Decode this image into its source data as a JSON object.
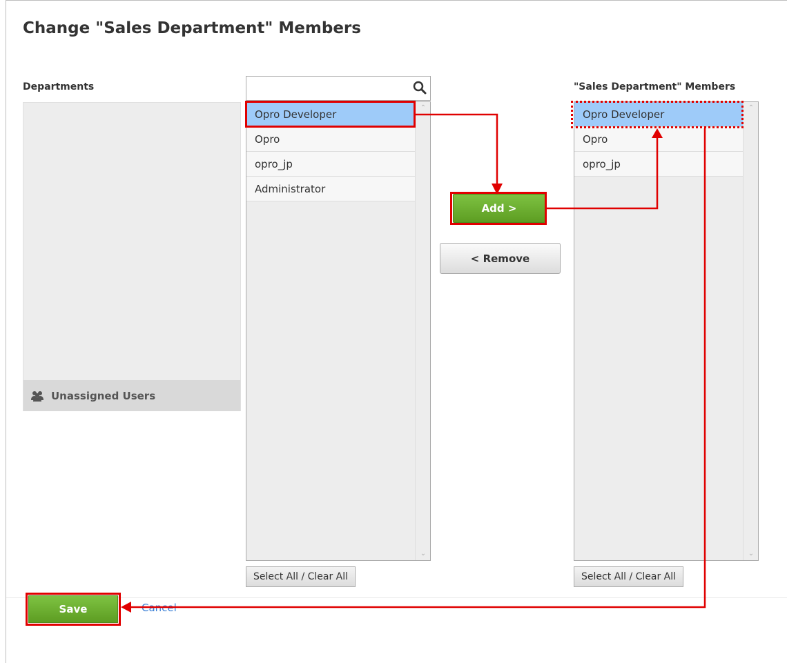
{
  "page": {
    "title": "Change \"Sales Department\" Members"
  },
  "departments": {
    "label": "Departments",
    "unassigned_label": "Unassigned Users"
  },
  "search": {
    "placeholder": "",
    "value": ""
  },
  "available_users": {
    "items": [
      {
        "label": "Opro Developer",
        "selected": true
      },
      {
        "label": "Opro",
        "selected": false
      },
      {
        "label": "opro_jp",
        "selected": false
      },
      {
        "label": "Administrator",
        "selected": false
      }
    ],
    "select_all_label": "Select All / Clear All"
  },
  "actions": {
    "add_label": "Add >",
    "remove_label": "< Remove"
  },
  "members": {
    "label": "\"Sales Department\" Members",
    "items": [
      {
        "label": "Opro Developer",
        "selected": true
      },
      {
        "label": "Opro",
        "selected": false
      },
      {
        "label": "opro_jp",
        "selected": false
      }
    ],
    "select_all_label": "Select All / Clear All"
  },
  "footer": {
    "save_label": "Save",
    "cancel_label": "Cancel"
  },
  "colors": {
    "primary_green": "#6aab2e",
    "selection_blue": "#9ecbf9",
    "annotation_red": "#e00000",
    "link_blue": "#3a7fd5"
  },
  "icons": {
    "search": "search-icon",
    "users": "users-icon",
    "scroll_up": "chevron-up-icon",
    "scroll_down": "chevron-down-icon"
  }
}
